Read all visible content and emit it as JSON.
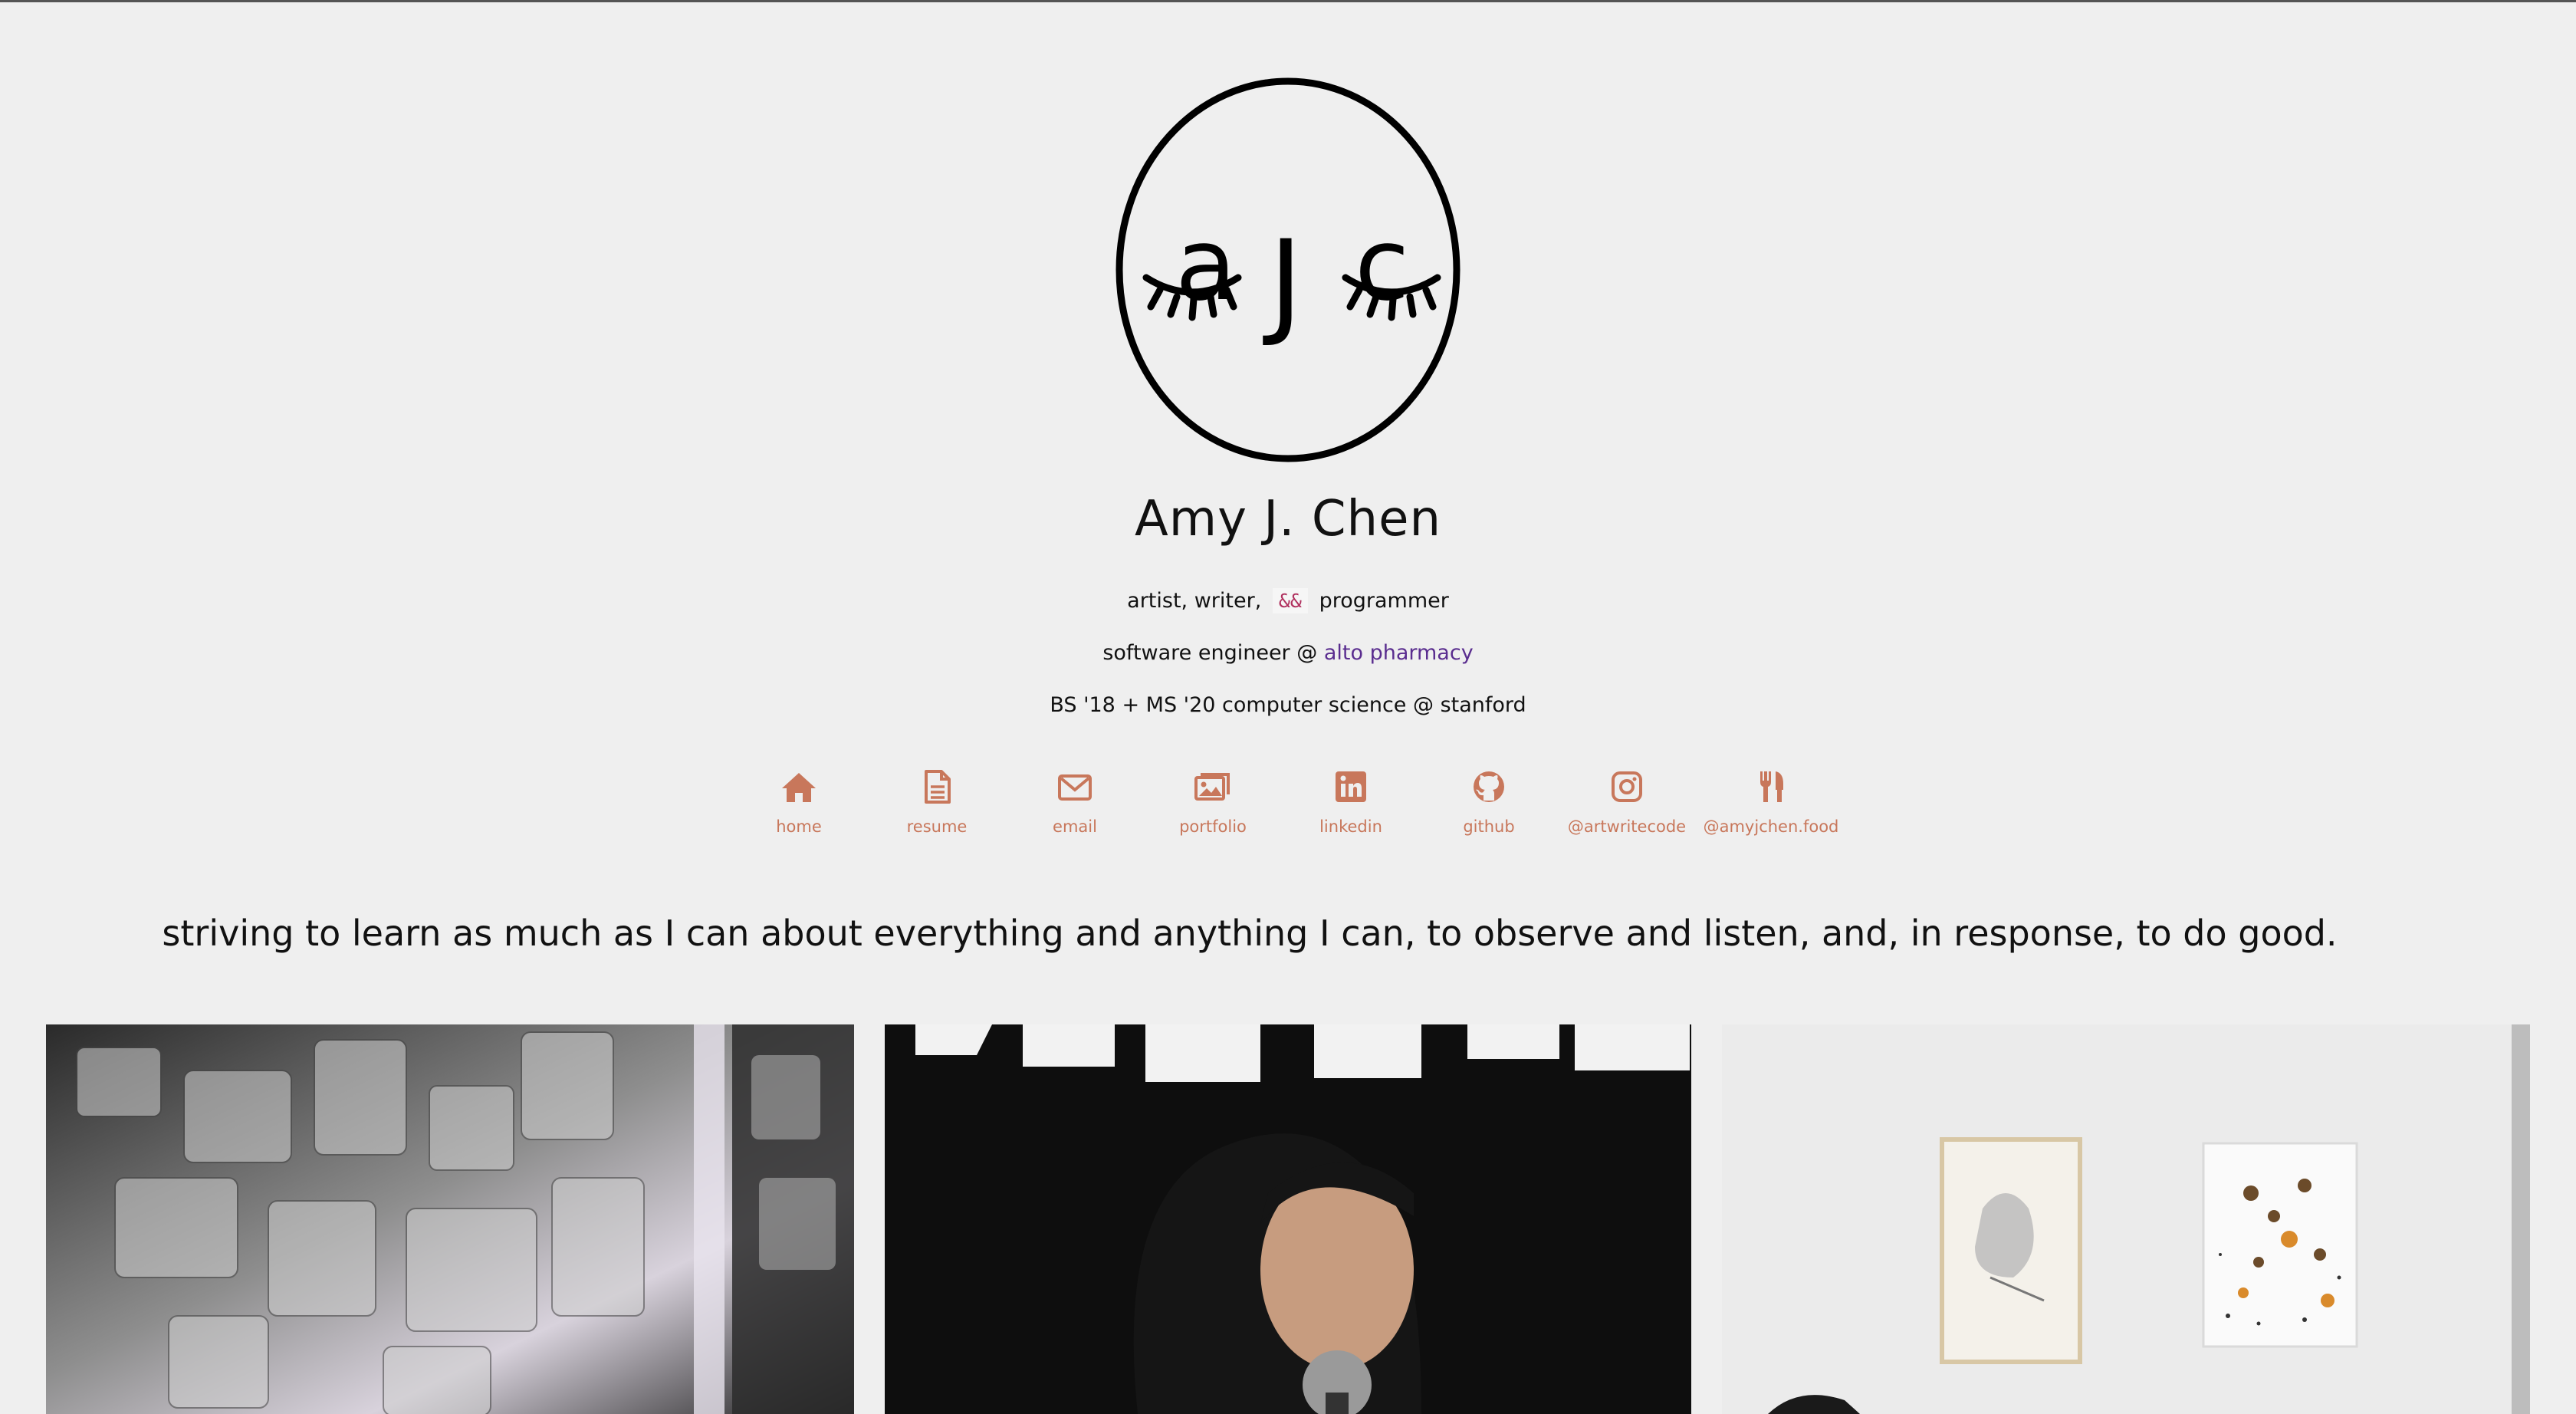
{
  "profile": {
    "name": "Amy J. Chen",
    "roles_before": "artist, writer,",
    "roles_amp": "&&",
    "roles_after": "programmer",
    "job_prefix": "software engineer @",
    "job_company": "alto pharmacy",
    "education": "BS '18 + MS '20 computer science @ stanford"
  },
  "logo": {
    "letters": [
      "a",
      "J",
      "c"
    ]
  },
  "nav": [
    {
      "label": "home",
      "icon": "home-icon"
    },
    {
      "label": "resume",
      "icon": "document-icon"
    },
    {
      "label": "email",
      "icon": "envelope-icon"
    },
    {
      "label": "portfolio",
      "icon": "images-icon"
    },
    {
      "label": "linkedin",
      "icon": "linkedin-icon"
    },
    {
      "label": "github",
      "icon": "github-icon"
    },
    {
      "label": "@artwritecode",
      "icon": "instagram-icon"
    },
    {
      "label": "@amyjchen.food",
      "icon": "utensils-icon"
    }
  ],
  "motto": "striving to learn as much as I can about everything and anything I can, to observe and listen, and, in response, to do good.",
  "colors": {
    "background": "#efefef",
    "nav_accent": "#c8775b",
    "amp_accent": "#b0305e",
    "link": "#5a2d8f"
  }
}
